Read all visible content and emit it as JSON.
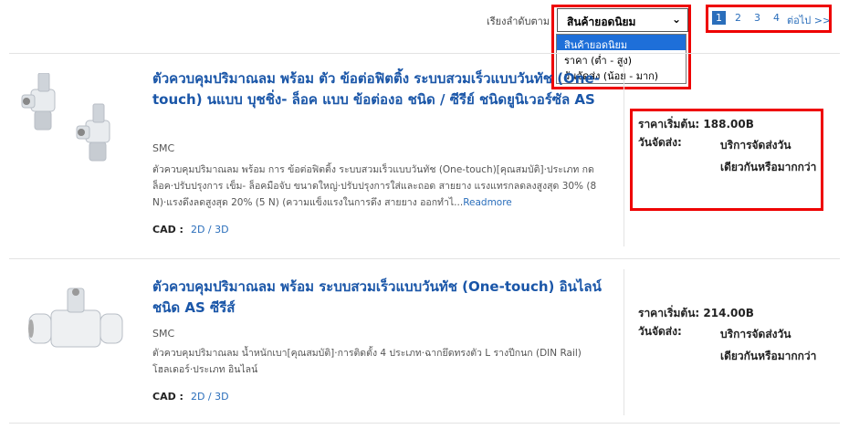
{
  "sort": {
    "label": "เรียงลำดับตาม",
    "selected": "สินค้ายอดนิยม",
    "options": [
      "สินค้ายอดนิยม",
      "ราคา (ต่ำ - สูง)",
      "วันจัดส่ง (น้อย - มาก)"
    ]
  },
  "pager": {
    "pages": [
      "1",
      "2",
      "3",
      "4"
    ],
    "next": "ต่อไป >>"
  },
  "items": [
    {
      "title": "ตัวควบคุมปริมาณลม พร้อม ตัว ข้อต่อฟิตติ้ง ระบบสวมเร็วแบบวันทัช (One-touch) นแบบ บุชชิ่ง- ล็อค แบบ ข้อต่องอ ชนิด / ซีรีย์ ชนิดยูนิเวอร์ซัล AS",
      "maker": "SMC",
      "desc": "ตัวควบคุมปริมาณลม พร้อม การ ข้อต่อฟิตติ้ง ระบบสวมเร็วแบบวันทัช (One-touch)[คุณสมบัติ]·ประเภท กด ล็อค·ปรับปรุงการ เข็ม- ล็อคมือจับ ขนาดใหญ่·ปรับปรุงการใส่และถอด สายยาง แรงแทรกลดลงสูงสุด 30% (8 N)·แรงดึงลดสูงสุด 20% (5 N) (ความแข็งแรงในการดึง สายยาง ออกทำไ...",
      "readmore": "Readmore",
      "cad_label": "CAD :",
      "cad_link": "2D / 3D",
      "price_label": "ราคาเริ่มต้น:",
      "price": "188.00B",
      "ship_label": "วันจัดส่ง:",
      "ship_value": "บริการจัดส่งวันเดียวกันหรือมากกว่า"
    },
    {
      "title": "ตัวควบคุมปริมาณลม พร้อม ระบบสวมเร็วแบบวันทัช (One-touch) อินไลน์ ชนิด AS ซีรีส์",
      "maker": "SMC",
      "desc": "ตัวควบคุมปริมาณลม น้ำหนักเบา[คุณสมบัติ]·การติดตั้ง 4 ประเภท·ฉากยึดทรงตัว L รางปีกนก (DIN Rail) โฮลเดอร์·ประเภท อินไลน์",
      "readmore": "",
      "cad_label": "CAD :",
      "cad_link": "2D / 3D",
      "price_label": "ราคาเริ่มต้น:",
      "price": "214.00B",
      "ship_label": "วันจัดส่ง:",
      "ship_value": "บริการจัดส่งวันเดียวกันหรือมากกว่า"
    }
  ]
}
